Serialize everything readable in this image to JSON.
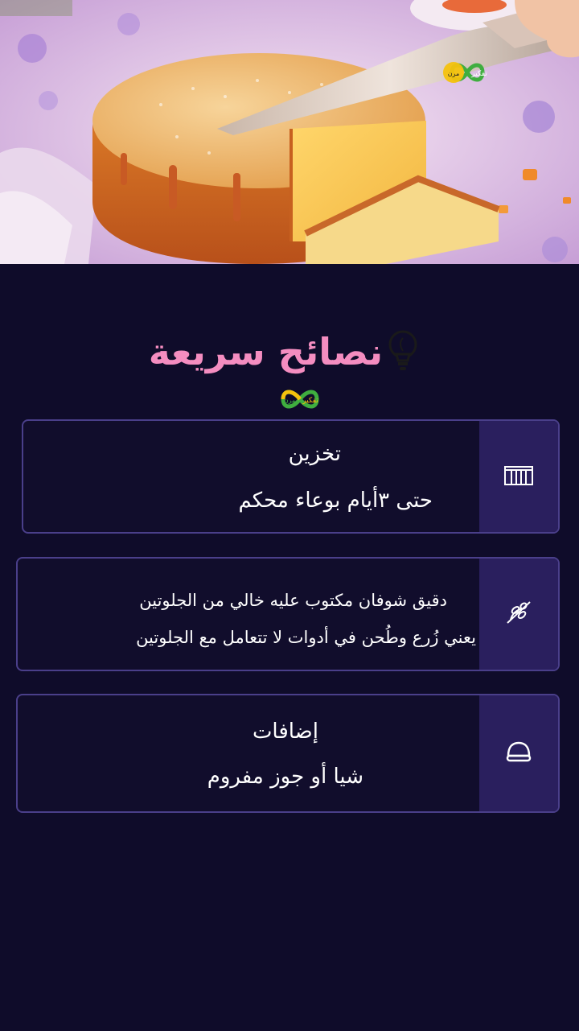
{
  "hero": {
    "logo_text_top": "تفكير",
    "logo_text_bottom": "مرن"
  },
  "header": {
    "title": "نصائح سريعة",
    "icon": "lightbulb-icon"
  },
  "logo": {
    "text_top": "تفكير",
    "text_bottom": "مرن"
  },
  "tips": [
    {
      "icon": "storage-box-icon",
      "title": "تخزين",
      "text": "حتى  ٣أيام بوعاء محكم"
    },
    {
      "icon": "no-gluten-icon",
      "title": "دقيق شوفان مكتوب عليه خالي من الجلوتين",
      "text": "يعني زُرع وطُحن في أدوات لا تتعامل مع الجلوتين"
    },
    {
      "icon": "nut-icon",
      "title": "إضافات",
      "text": "شيا أو جوز مفروم"
    }
  ],
  "colors": {
    "background": "#0f0c2a",
    "title": "#f48dc0",
    "card_border": "#4a3f8a",
    "card_side": "#2a1f5e"
  }
}
